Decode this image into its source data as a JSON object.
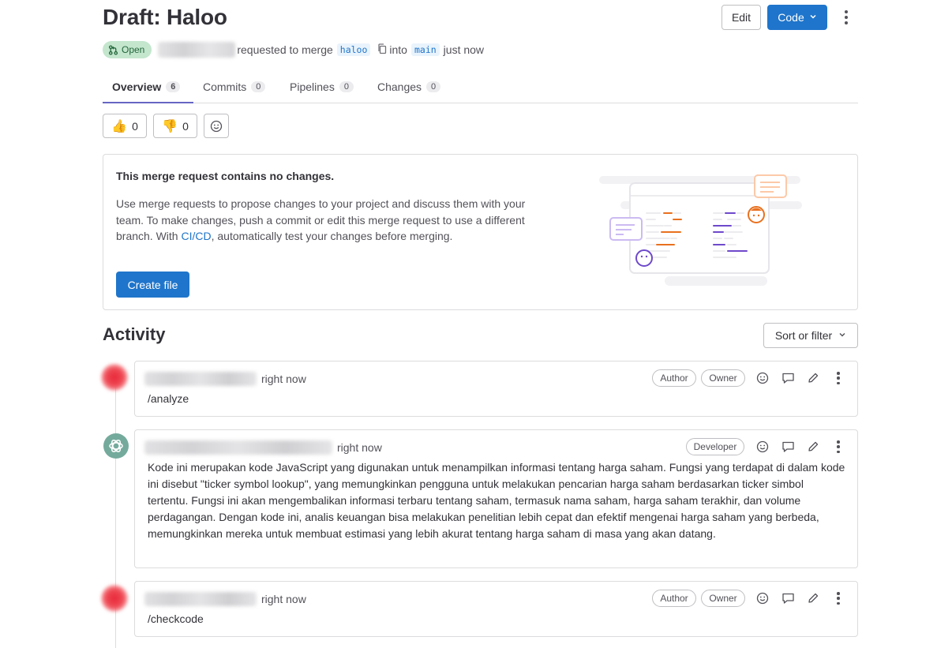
{
  "header": {
    "title": "Draft: Haloo",
    "edit_label": "Edit",
    "code_label": "Code"
  },
  "meta": {
    "status": "Open",
    "requested_text": "requested to merge",
    "source_branch": "haloo",
    "into_text": "into",
    "target_branch": "main",
    "time_text": "just now"
  },
  "tabs": [
    {
      "label": "Overview",
      "count": "6"
    },
    {
      "label": "Commits",
      "count": "0"
    },
    {
      "label": "Pipelines",
      "count": "0"
    },
    {
      "label": "Changes",
      "count": "0"
    }
  ],
  "reactions": {
    "thumbs_up": {
      "emoji": "👍",
      "count": "0"
    },
    "thumbs_down": {
      "emoji": "👎",
      "count": "0"
    }
  },
  "empty_state": {
    "title": "This merge request contains no changes.",
    "desc_before": "Use merge requests to propose changes to your project and discuss them with your team. To make changes, push a commit or edit this merge request to use a different branch. With ",
    "desc_link": "CI/CD",
    "desc_after": ", automatically test your changes before merging.",
    "button": "Create file"
  },
  "activity": {
    "title": "Activity",
    "sort_label": "Sort or filter",
    "notes": [
      {
        "time": "right now",
        "body": "/analyze",
        "badges": [
          "Author",
          "Owner"
        ]
      },
      {
        "time": "right now",
        "body": "Kode ini merupakan kode JavaScript yang digunakan untuk menampilkan informasi tentang harga saham. Fungsi yang terdapat di dalam kode ini disebut \"ticker symbol lookup\", yang memungkinkan pengguna untuk melakukan pencarian harga saham berdasarkan ticker simbol tertentu. Fungsi ini akan mengembalikan informasi terbaru tentang saham, termasuk nama saham, harga saham terakhir, dan volume perdagangan. Dengan kode ini, analis keuangan bisa melakukan penelitian lebih cepat dan efektif mengenai harga saham yang berbeda, memungkinkan mereka untuk membuat estimasi yang lebih akurat tentang harga saham di masa yang akan datang.",
        "badges": [
          "Developer"
        ]
      },
      {
        "time": "right now",
        "body": "/checkcode",
        "badges": [
          "Author",
          "Owner"
        ]
      }
    ]
  },
  "colors": {
    "primary": "#1f75cb",
    "tab_underline": "#6666c4",
    "open_badge_bg": "#c3e6cd",
    "open_badge_fg": "#24663b",
    "gpt_avatar": "#74aa9c"
  }
}
